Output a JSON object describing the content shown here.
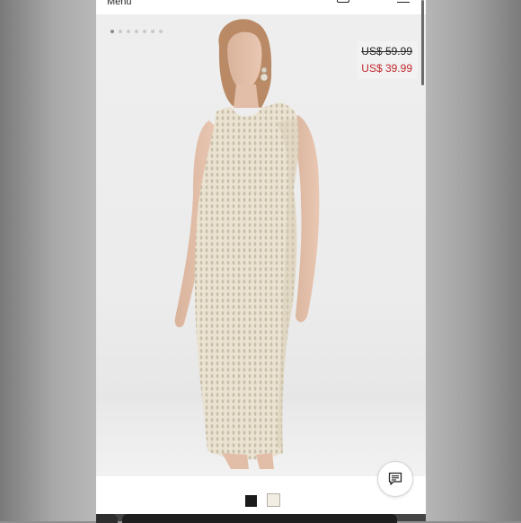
{
  "header": {
    "menu_label": "Menu",
    "icons": [
      "bag-icon",
      "hamburger-icon"
    ]
  },
  "gallery": {
    "image_count": 7,
    "active_index": 0
  },
  "product": {
    "original_price": "US$ 59.99",
    "sale_price": "US$ 39.99",
    "colors": [
      {
        "name": "black",
        "hex": "#1b1b1b"
      },
      {
        "name": "cream",
        "hex": "#f2eee4"
      }
    ],
    "selected_color": "cream"
  },
  "chat": {
    "icon": "chat-icon"
  },
  "theme": {
    "sale_color": "#c0262c",
    "text_color": "#222222"
  }
}
